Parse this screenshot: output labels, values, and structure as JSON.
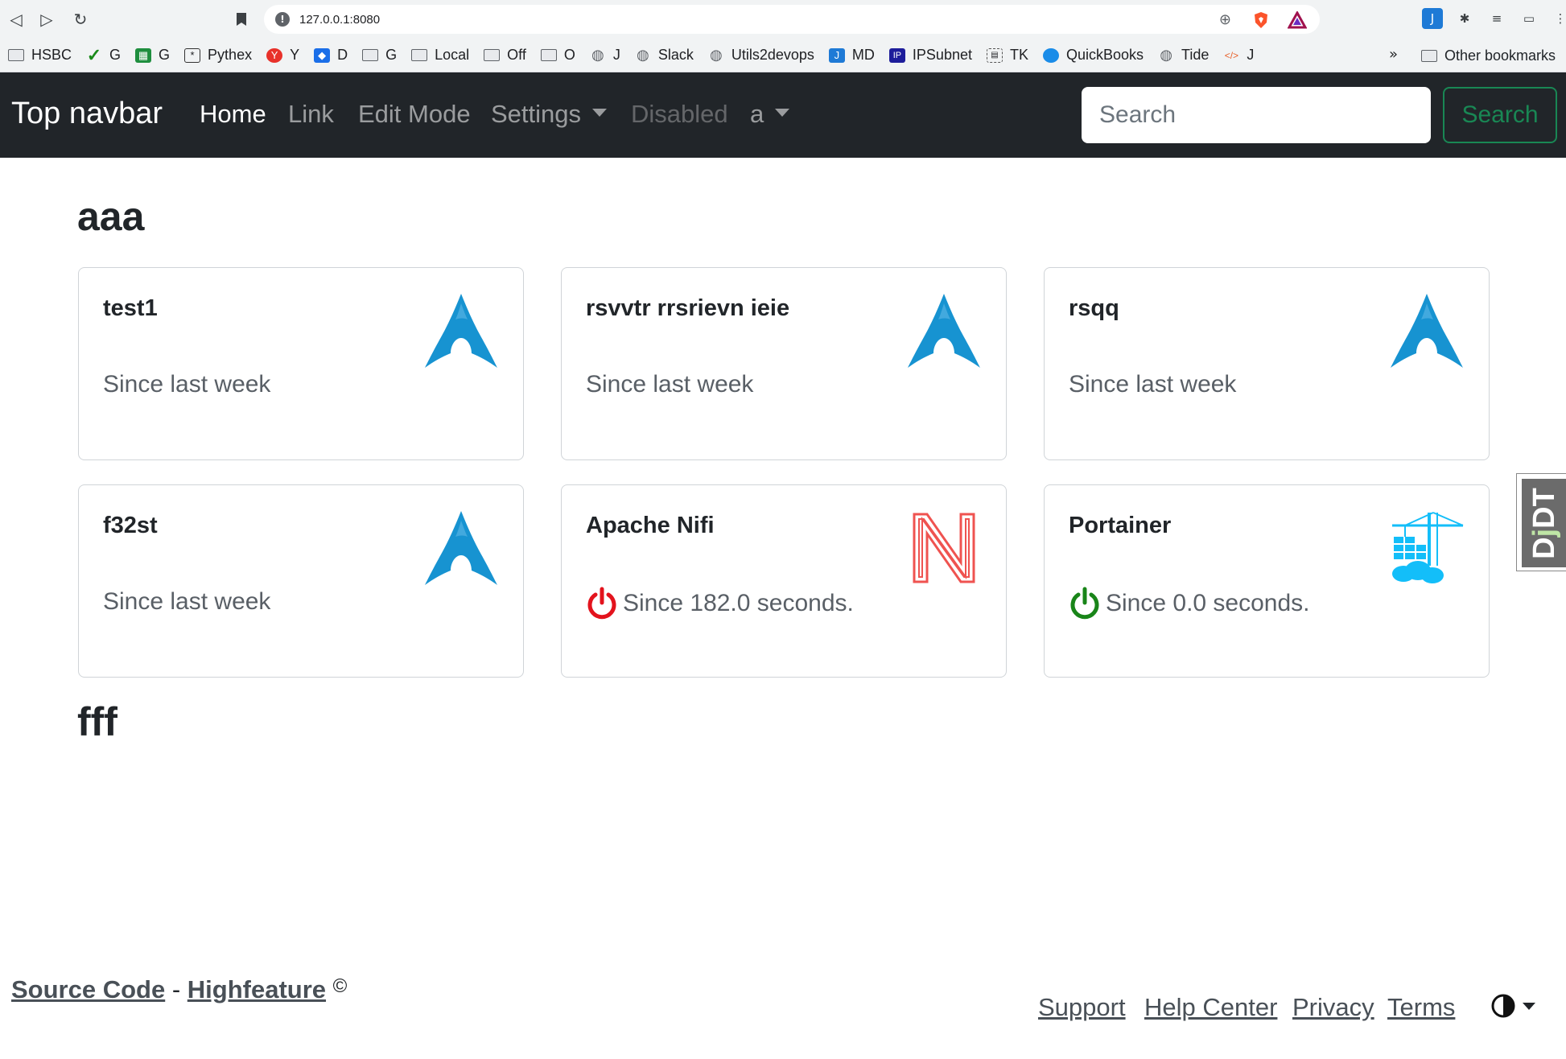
{
  "browser": {
    "url": "127.0.0.1:8080",
    "bookmarks": [
      {
        "label": "HSBC",
        "icon": "folder-icon"
      },
      {
        "label": "G",
        "icon": "checkmark-icon"
      },
      {
        "label": "G",
        "icon": "sheets-icon"
      },
      {
        "label": "Pythex",
        "icon": "pythex-icon"
      },
      {
        "label": "Y",
        "icon": "y-icon"
      },
      {
        "label": "D",
        "icon": "dropbox-icon"
      },
      {
        "label": "G",
        "icon": "folder-icon"
      },
      {
        "label": "Local",
        "icon": "folder-icon"
      },
      {
        "label": "Off",
        "icon": "folder-icon"
      },
      {
        "label": "O",
        "icon": "folder-icon"
      },
      {
        "label": "J",
        "icon": "globe-icon"
      },
      {
        "label": "Slack",
        "icon": "globe-icon"
      },
      {
        "label": "Utils2devops",
        "icon": "globe-icon"
      },
      {
        "label": "MD",
        "icon": "j-icon"
      },
      {
        "label": "IPSubnet",
        "icon": "ip-icon"
      },
      {
        "label": "TK",
        "icon": "tk-icon"
      },
      {
        "label": "QuickBooks",
        "icon": "quickbooks-icon"
      },
      {
        "label": "Tide",
        "icon": "globe-icon"
      },
      {
        "label": "J",
        "icon": "code-icon"
      }
    ],
    "more": "»",
    "other_bookmarks": "Other bookmarks"
  },
  "navbar": {
    "brand": "Top navbar",
    "items": [
      {
        "label": "Home",
        "state": "active"
      },
      {
        "label": "Link",
        "state": "normal"
      },
      {
        "label": "Edit Mode",
        "state": "normal"
      },
      {
        "label": "Settings",
        "state": "dropdown"
      },
      {
        "label": "Disabled",
        "state": "disabled"
      },
      {
        "label": "a",
        "state": "dropdown"
      }
    ],
    "search_placeholder": "Search",
    "search_button": "Search"
  },
  "sections": [
    {
      "title": "aaa",
      "cards": [
        {
          "title": "test1",
          "subtitle": "Since last week",
          "icon": "arch-linux-icon"
        },
        {
          "title": "rsvvtr rrsrievn ieie",
          "subtitle": "Since last week",
          "icon": "arch-linux-icon"
        },
        {
          "title": "rsqq",
          "subtitle": "Since last week",
          "icon": "arch-linux-icon"
        },
        {
          "title": "f32st",
          "subtitle": "Since last week",
          "icon": "arch-linux-icon"
        },
        {
          "title": "Apache Nifi",
          "status": "Since 182.0 seconds.",
          "status_color": "#e3131d",
          "icon": "nifi-icon"
        },
        {
          "title": "Portainer",
          "status": "Since 0.0 seconds.",
          "status_color": "#198519",
          "icon": "portainer-icon"
        }
      ]
    },
    {
      "title": "fff",
      "cards": []
    }
  ],
  "djdt": {
    "label_d": "D",
    "label_j": "j",
    "label_dt": "DT"
  },
  "footer": {
    "source_code": "Source Code",
    "separator": " - ",
    "highfeature": "Highfeature",
    "copyright": "©",
    "links": [
      "Support",
      "Help Center",
      "Privacy",
      "Terms"
    ]
  },
  "colors": {
    "navbar_bg": "#212529",
    "success": "#198754",
    "arch_blue": "#1793d1"
  }
}
